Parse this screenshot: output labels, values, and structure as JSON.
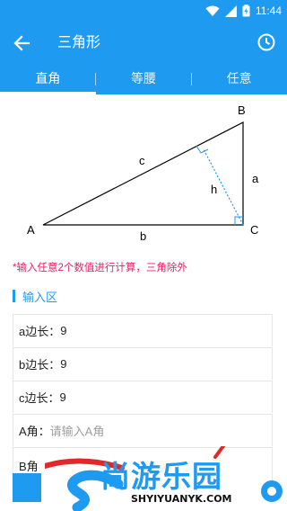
{
  "status": {
    "time": "11:44"
  },
  "appbar": {
    "title": "三角形"
  },
  "tabs": [
    {
      "label": "直角",
      "active": true
    },
    {
      "label": "等腰",
      "active": false
    },
    {
      "label": "任意",
      "active": false
    }
  ],
  "diagram": {
    "vertices": {
      "A": "A",
      "B": "B",
      "C": "C"
    },
    "sides": {
      "a": "a",
      "b": "b",
      "c": "c",
      "h": "h"
    }
  },
  "note": "*输入任意2个数值进行计算，三角除外",
  "input_section": {
    "title": "输入区",
    "fields": [
      {
        "label": "a边长：",
        "value": "9",
        "placeholder": ""
      },
      {
        "label": "b边长：",
        "value": "9",
        "placeholder": ""
      },
      {
        "label": "c边长：",
        "value": "9",
        "placeholder": ""
      },
      {
        "label": "A角：",
        "value": "",
        "placeholder": "请输入A角"
      },
      {
        "label": "B角",
        "value": "",
        "placeholder": ""
      }
    ]
  },
  "watermark": {
    "text": "尚游乐园",
    "sub": "SHYIYUANYK.COM"
  },
  "colors": {
    "primary": "#1e9bf0",
    "note": "#e91e63",
    "watermark_red": "#e02a2a"
  }
}
